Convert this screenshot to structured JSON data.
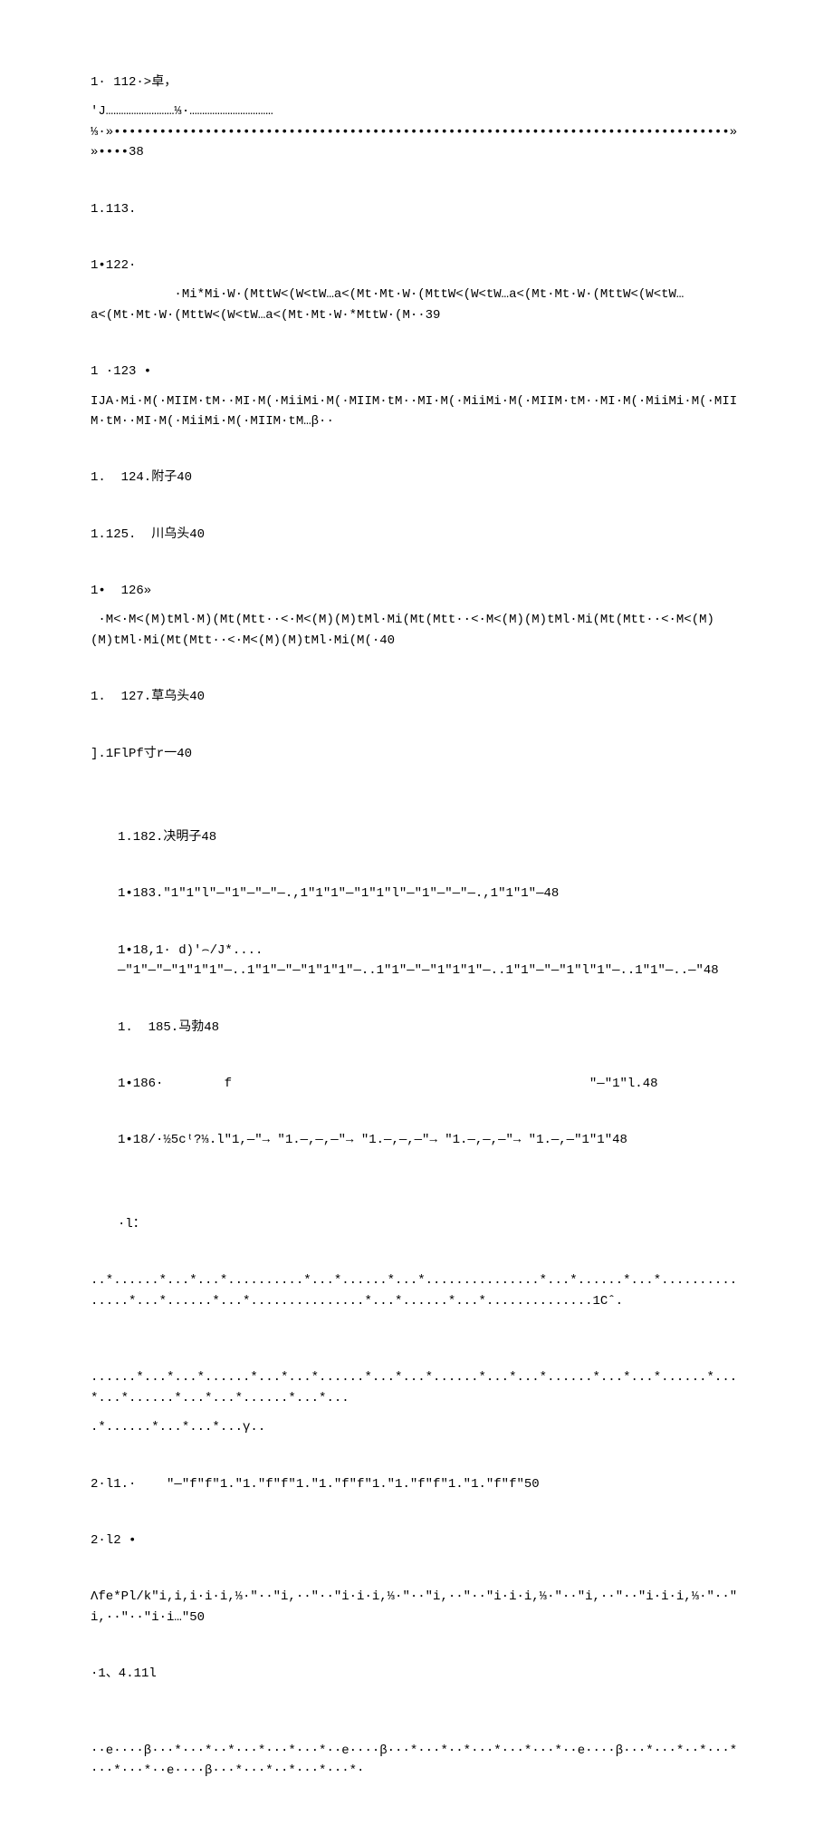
{
  "lines": [
    {
      "text": "1· 112·>卓，",
      "indent": ""
    },
    {
      "text": "'J………………………⅓·……………………………⅓·»•••••••••••••••••••••••••••••••••••••••••••••••••••••••••••••••••••••••••••••••••»»••••38",
      "indent": ""
    },
    {
      "text": "",
      "indent": "",
      "gap": true
    },
    {
      "text": "1.113.",
      "indent": ""
    },
    {
      "text": "",
      "indent": "",
      "gap": true
    },
    {
      "text": "1•122·",
      "indent": ""
    },
    {
      "text": "           ·Mi*Mi·W·(MttW<(W<tW…a<(Mt·Mt·W·(MttW<(W<tW…a<(Mt·Mt·W·(MttW<(W<tW…a<(Mt·Mt·W·(MttW<(W<tW…a<(Mt·Mt·W·*MttW·(M··39",
      "indent": ""
    },
    {
      "text": "",
      "indent": "",
      "gap": true
    },
    {
      "text": "1 ·123 •",
      "indent": ""
    },
    {
      "text": "IJA·Mi·M(·MIIM·tM··MI·M(·MiiMi·M(·MIIM·tM··MI·M(·MiiMi·M(·MIIM·tM··MI·M(·MiiMi·M(·MIIM·tM··MI·M(·MiiMi·M(·MIIM·tM…β··",
      "indent": ""
    },
    {
      "text": "",
      "indent": "",
      "gap": true
    },
    {
      "text": "1.  124.附子40",
      "indent": ""
    },
    {
      "text": "",
      "indent": "",
      "gap": true
    },
    {
      "text": "1.125.  川乌头40",
      "indent": ""
    },
    {
      "text": "",
      "indent": "",
      "gap": true
    },
    {
      "text": "1•  126»",
      "indent": ""
    },
    {
      "text": " ·M<·M<(M)tMl·M)(Mt(Mtt··<·M<(M)(M)tMl·Mi(Mt(Mtt··<·M<(M)(M)tMl·Mi(Mt(Mtt··<·M<(M)(M)tMl·Mi(Mt(Mtt··<·M<(M)(M)tMl·Mi(M(·40",
      "indent": ""
    },
    {
      "text": "",
      "indent": "",
      "gap": true
    },
    {
      "text": "1.  127.草乌头40",
      "indent": ""
    },
    {
      "text": "",
      "indent": "",
      "gap": true
    },
    {
      "text": "].1FlPf寸r一40",
      "indent": ""
    },
    {
      "text": "",
      "indent": "",
      "gap": true
    },
    {
      "text": "",
      "indent": "",
      "gap": true
    },
    {
      "text": "1.182.决明子48",
      "indent": "indent1"
    },
    {
      "text": "",
      "indent": "",
      "gap": true
    },
    {
      "text": "1•183.\"1\"1\"l\"—\"1\"—\"—\"—.,1\"1\"1\"—\"1\"1\"l\"—\"1\"—\"—\"—.,1\"1\"1\"—48",
      "indent": "indent1"
    },
    {
      "text": "",
      "indent": "",
      "gap": true
    },
    {
      "text": "1•18,1· d)′⌢/J*....—\"1\"—\"—\"1\"1\"1\"—..1\"1\"—\"—\"1\"1\"1\"—..1\"1\"—\"—\"1\"1\"1\"—..1\"1\"—\"—\"1\"l\"1\"—..1\"1\"—..—\"48",
      "indent": "indent1"
    },
    {
      "text": "",
      "indent": "",
      "gap": true
    },
    {
      "text": "1.  185.马勃48",
      "indent": "indent1"
    },
    {
      "text": "",
      "indent": "",
      "gap": true
    },
    {
      "text": "1•186·        f                                               \"—\"1\"l.48",
      "indent": "indent1"
    },
    {
      "text": "",
      "indent": "",
      "gap": true
    },
    {
      "text": "1•18/·½5cᵗ?⅓.l\"1,—″→ \"1.—,—,—″→ \"1.—,—,—″→ \"1.—,—,—″→ \"1.—,—\"1\"1\"48",
      "indent": "indent1"
    },
    {
      "text": "",
      "indent": "",
      "gap": true
    },
    {
      "text": "",
      "indent": "",
      "gap": true
    },
    {
      "text": "·l：",
      "indent": "indent1"
    },
    {
      "text": "",
      "indent": "",
      "gap": true
    },
    {
      "text": "..*......*...*...*..........*...*......*...*...............*...*......*...*...............*...*......*...*...............*...*......*...*..............1Cˆ.",
      "indent": ""
    },
    {
      "text": "",
      "indent": "",
      "gap": true
    },
    {
      "text": "                    ......*...*...*......*...*...*......*...*...*......*...*...*......*...*...*......*...*...*......*...*...*......*...*...",
      "indent": ""
    },
    {
      "text": ".*......*...*...*...γ..",
      "indent": ""
    },
    {
      "text": "",
      "indent": "",
      "gap": true
    },
    {
      "text": "2·l1.·    \"—\"f\"f\"1.\"1.\"f\"f\"1.\"1.\"f\"f\"1.\"1.\"f\"f\"1.\"1.\"f\"f\"50",
      "indent": ""
    },
    {
      "text": "",
      "indent": "",
      "gap": true
    },
    {
      "text": "2·l2 •",
      "indent": ""
    },
    {
      "text": "",
      "indent": "",
      "gap": true
    },
    {
      "text": "Λfe*Pl/k\"i,i,i·i·i,⅓·\"··\"i,··\"··\"i·i·i,⅓·\"··\"i,··\"··\"i·i·i,⅓·\"··\"i,··\"··\"i·i·i,⅓·\"··\"i,··\"··\"i·i…\"50",
      "indent": ""
    },
    {
      "text": "",
      "indent": "",
      "gap": true
    },
    {
      "text": "·1、4.11l",
      "indent": ""
    },
    {
      "text": "",
      "indent": "",
      "gap": true
    },
    {
      "text": "      ··e····β···*···*··*···*···*···*··e····β···*···*··*···*···*···*··e····β···*···*··*···*···*···*··e····β···*···*··*···*···*·",
      "indent": ""
    }
  ]
}
